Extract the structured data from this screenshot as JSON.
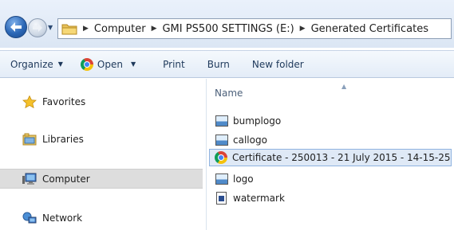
{
  "address_bar": {
    "breadcrumbs": [
      "Computer",
      "GMI PS500 SETTINGS (E:)",
      "Generated Certificates"
    ]
  },
  "toolbar": {
    "organize_label": "Organize",
    "open_label": "Open",
    "print_label": "Print",
    "burn_label": "Burn",
    "new_folder_label": "New folder"
  },
  "nav_pane": {
    "items": [
      {
        "label": "Favorites",
        "icon": "star-icon"
      },
      {
        "label": "Libraries",
        "icon": "libraries-icon"
      },
      {
        "label": "Computer",
        "icon": "computer-icon",
        "selected": true
      },
      {
        "label": "Network",
        "icon": "network-icon"
      }
    ]
  },
  "content": {
    "column_header": "Name",
    "files": [
      {
        "name": "bumplogo",
        "icon": "image-file-icon"
      },
      {
        "name": "callogo",
        "icon": "image-file-icon"
      },
      {
        "name": "Certificate - 250013 - 21 July 2015 - 14-15-25",
        "icon": "chrome-html-icon",
        "selected": true
      },
      {
        "name": "logo",
        "icon": "image-file-icon"
      },
      {
        "name": "watermark",
        "icon": "document-file-icon"
      }
    ]
  },
  "colors": {
    "toolbar_text": "#1e395b",
    "selection_background": "#dfe9f6",
    "selection_border": "#8fb3e0",
    "nav_selected_background": "#dddddd"
  }
}
